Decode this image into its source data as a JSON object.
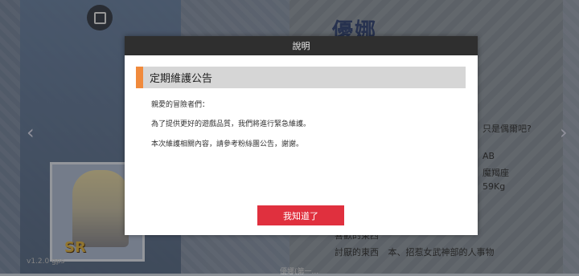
{
  "background": {
    "character_name": "優娜",
    "info_question": "只是偶爾吧?",
    "blood_type": "AB",
    "zodiac": "魔羯座",
    "weight": "59Kg",
    "favorite_line": "喜歡的東西",
    "dislike_label": "討厭的東西",
    "dislike_value": "本、招惹女武神部的人事物",
    "rarity_badge": "SR",
    "version": "v1.2.0 gps",
    "bottom_caption": "優娜(第一..."
  },
  "modal": {
    "title": "說明",
    "notice_title": "定期維護公告",
    "lines": [
      "親愛的冒險者們：",
      "為了提供更好的遊戲品質，我們將進行緊急維護。",
      "本次維護相關內容，請參考粉絲團公告，謝謝。"
    ],
    "confirm_label": "我知道了"
  },
  "colors": {
    "accent": "#f08a3c",
    "confirm": "#e0303e",
    "title_bar": "#2f2f2f"
  }
}
